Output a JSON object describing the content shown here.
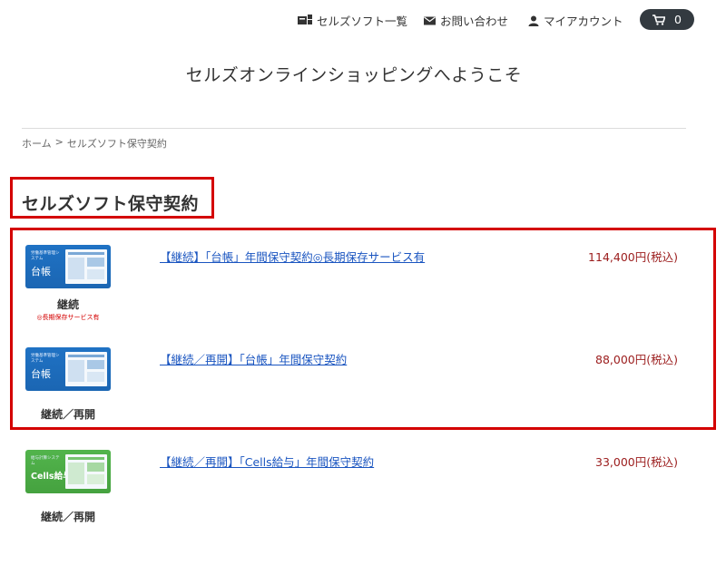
{
  "header": {
    "nav": [
      {
        "label": "セルズソフト一覧",
        "icon": "software-list-icon"
      },
      {
        "label": "お問い合わせ",
        "icon": "mail-icon"
      },
      {
        "label": "マイアカウント",
        "icon": "user-icon"
      }
    ],
    "cart_count": "0",
    "welcome": "セルズオンラインショッピングへようこそ"
  },
  "breadcrumb": {
    "home": "ホーム",
    "separator": ">",
    "current": "セルズソフト保守契約"
  },
  "page_title": "セルズソフト保守契約",
  "products": [
    {
      "thumb_sub": "労働基準管理システム",
      "thumb_name": "台帳",
      "caption": "継続",
      "caption_sub": "◎長期保存サービス有",
      "link": "【継続】「台帳」年間保守契約◎長期保存サービス有",
      "price": "114,400円(税込)"
    },
    {
      "thumb_sub": "労働基準管理システム",
      "thumb_name": "台帳",
      "caption": "継続／再開",
      "link": "【継続／再開】「台帳」年間保守契約",
      "price": "88,000円(税込)"
    },
    {
      "thumb_sub": "給与計算システム",
      "thumb_name": "Cells給与",
      "caption": "継続／再開",
      "link": "【継続／再開】「Cells給与」年間保守契約",
      "price": "33,000円(税込)"
    }
  ],
  "colors": {
    "highlight": "#d40000",
    "link": "#1a55c0",
    "price": "#9b1c1c",
    "cart": "#333a40"
  }
}
